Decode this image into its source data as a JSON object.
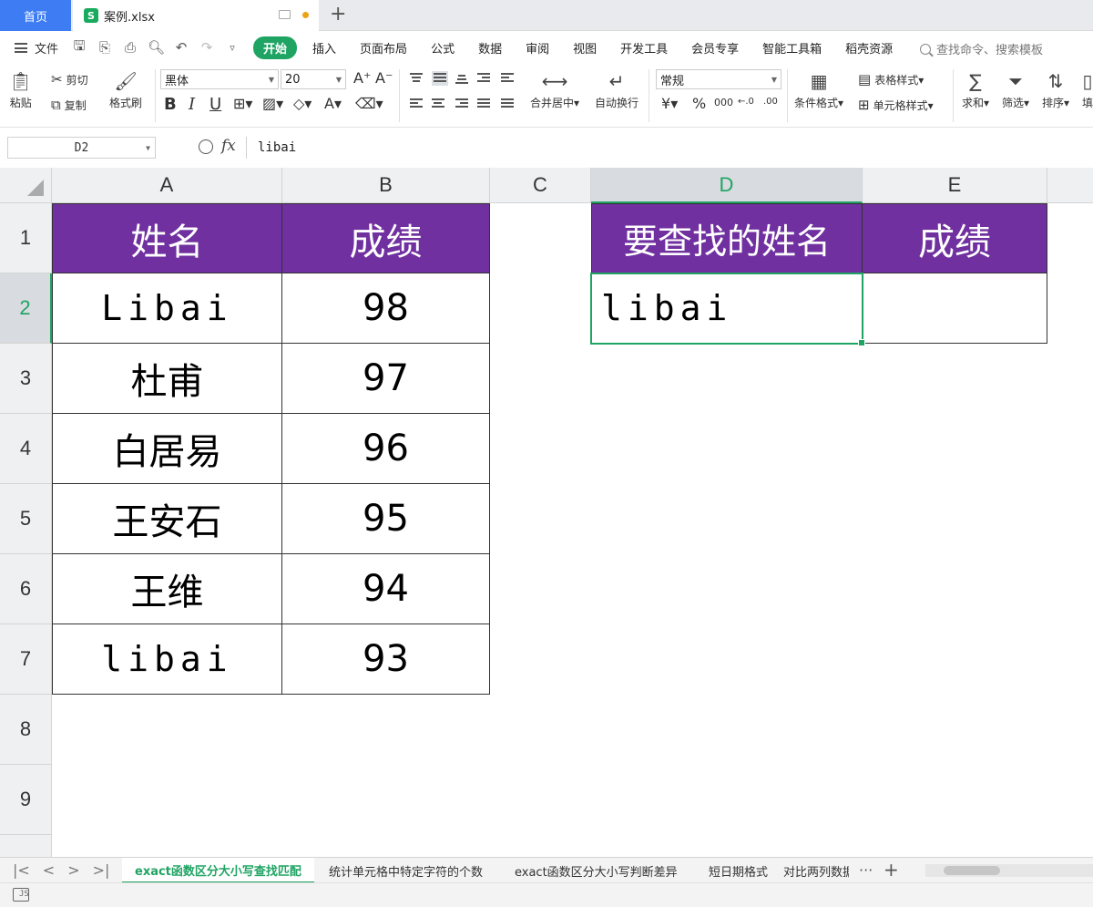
{
  "tabbar": {
    "home_label": "首页",
    "file_icon_letter": "S",
    "file_name": "案例.xlsx",
    "new_tab_label": "+"
  },
  "menubar": {
    "file_label": "文件",
    "tabs": [
      "开始",
      "插入",
      "页面布局",
      "公式",
      "数据",
      "审阅",
      "视图",
      "开发工具",
      "会员专享",
      "智能工具箱",
      "稻壳资源"
    ],
    "search_placeholder": "查找命令、搜索模板"
  },
  "ribbon": {
    "paste": "粘贴",
    "cut": "剪切",
    "copy": "复制",
    "format_painter": "格式刷",
    "font_name": "黑体",
    "font_size": "20",
    "grow_font": "A⁺",
    "shrink_font": "A⁻",
    "bold": "B",
    "italic": "I",
    "underline": "U",
    "merge_center": "合并居中",
    "wrap_text": "自动换行",
    "number_format": "常规",
    "currency": "¥",
    "percent": "%",
    "thousands": "000",
    "inc_decimal": "←.0",
    "dec_decimal": ".00",
    "conditional_format": "条件格式",
    "table_style": "表格样式",
    "cell_style": "单元格样式",
    "sum": "求和",
    "filter": "筛选",
    "sort": "排序",
    "fill_partial": "填"
  },
  "formulabar": {
    "cell_ref": "D2",
    "fx_label": "fx",
    "formula": "libai"
  },
  "columns": [
    "A",
    "B",
    "C",
    "D",
    "E"
  ],
  "rows": [
    "1",
    "2",
    "3",
    "4",
    "5",
    "6",
    "7",
    "8",
    "9"
  ],
  "selected": {
    "column": "D",
    "row": "2"
  },
  "table": {
    "header_name": "姓名",
    "header_score": "成绩",
    "records": [
      {
        "name": "Libai",
        "score": "98"
      },
      {
        "name": "杜甫",
        "score": "97"
      },
      {
        "name": "白居易",
        "score": "96"
      },
      {
        "name": "王安石",
        "score": "95"
      },
      {
        "name": "王维",
        "score": "94"
      },
      {
        "name": "libai",
        "score": "93"
      }
    ]
  },
  "lookup": {
    "header_name": "要查找的姓名",
    "header_score": "成绩",
    "name_value": "libai",
    "score_value": ""
  },
  "sheets": {
    "active": "exact函数区分大小写查找匹配",
    "others": [
      "统计单元格中特定字符的个数",
      "exact函数区分大小写判断差异",
      "短日期格式",
      "对比两列数据"
    ],
    "more": "···",
    "add": "+"
  },
  "colors": {
    "accent": "#1fa463",
    "header_fill": "#7030a0",
    "home_tab": "#3d7cf2"
  }
}
